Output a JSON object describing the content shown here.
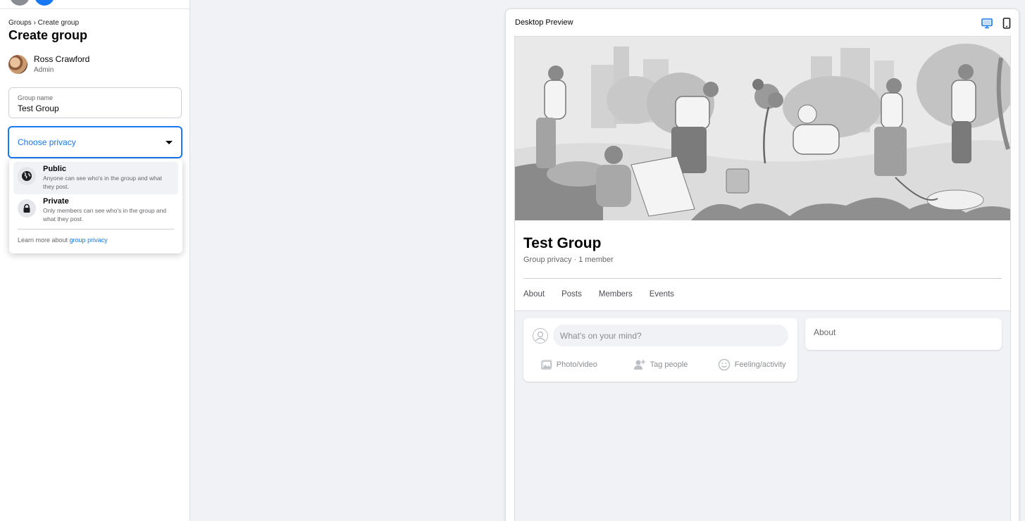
{
  "sidebar": {
    "breadcrumb": "Groups › Create group",
    "title": "Create group",
    "user": {
      "name": "Ross Crawford",
      "role": "Admin"
    },
    "group_name_field": {
      "label": "Group name",
      "value": "Test Group"
    },
    "privacy_select": {
      "placeholder": "Choose privacy"
    },
    "privacy_options": [
      {
        "title": "Public",
        "description": "Anyone can see who's in the group and what they post.",
        "icon": "globe-icon"
      },
      {
        "title": "Private",
        "description": "Only members can see who's in the group and what they post.",
        "icon": "lock-icon"
      }
    ],
    "learn_more": {
      "text": "Learn more about ",
      "link": "group privacy"
    }
  },
  "preview": {
    "title": "Desktop Preview",
    "group_title": "Test Group",
    "group_meta": "Group privacy · 1 member",
    "tabs": [
      "About",
      "Posts",
      "Members",
      "Events"
    ],
    "composer": {
      "placeholder": "What's on your mind?",
      "actions": [
        {
          "label": "Photo/video",
          "icon": "photo-icon"
        },
        {
          "label": "Tag people",
          "icon": "tag-people-icon"
        },
        {
          "label": "Feeling/activity",
          "icon": "smiley-icon"
        }
      ]
    },
    "about_card": {
      "title": "About"
    }
  },
  "colors": {
    "accent": "#1877f2",
    "background": "#f0f2f5",
    "text": "#050505",
    "muted": "#65676b"
  }
}
